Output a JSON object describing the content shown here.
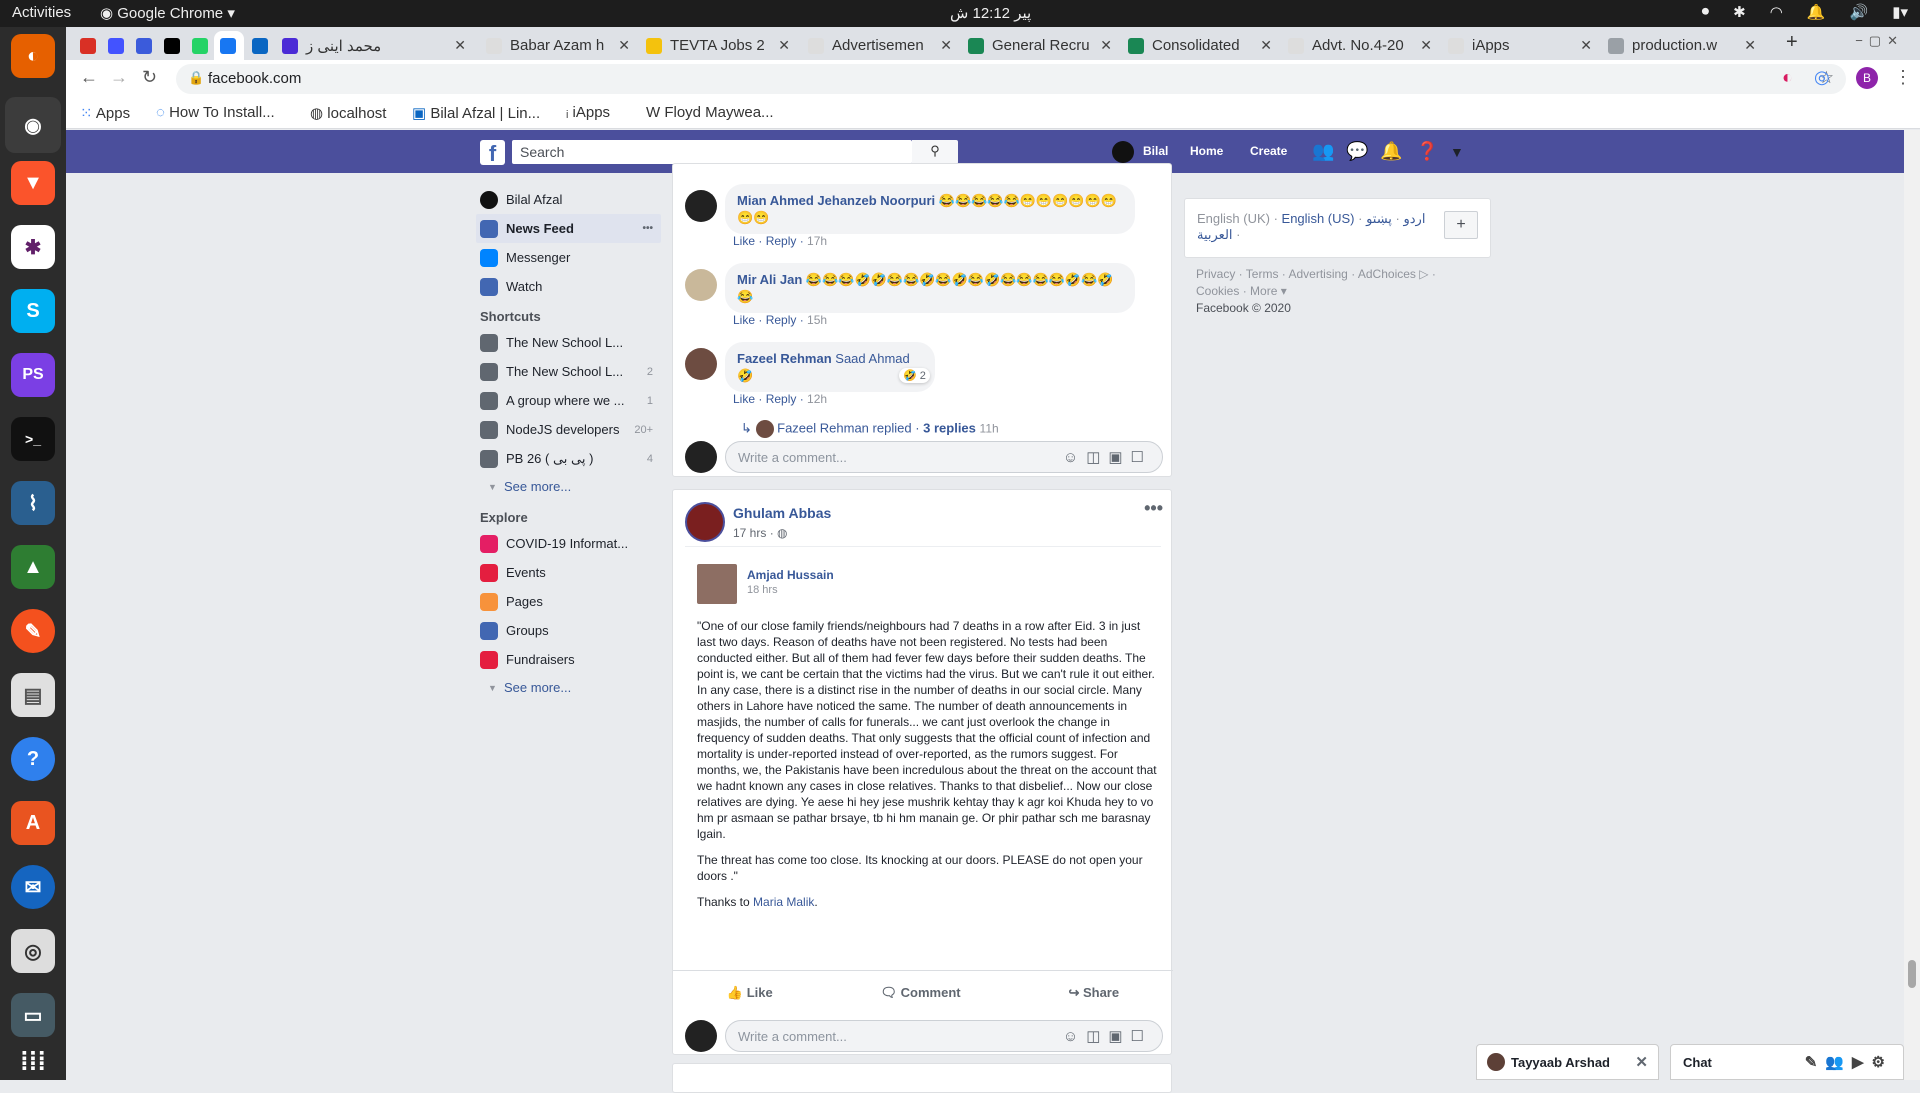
{
  "os": {
    "activities": "Activities",
    "app_name": "Google Chrome",
    "clock": "پیر 12:12 ش"
  },
  "tabs": [
    {
      "label": "",
      "color": "#d93025"
    },
    {
      "label": "",
      "color": "#4353ff"
    },
    {
      "label": "",
      "color": "#3b5bdb"
    },
    {
      "label": "",
      "color": "#000000"
    },
    {
      "label": "",
      "color": "#25d366"
    },
    {
      "label": "",
      "color": "#1877f2"
    },
    {
      "label": "",
      "color": "#0a66c2"
    },
    {
      "label": "محمد اینی ز",
      "color": "#4b2bd6"
    },
    {
      "label": "Babar Azam h",
      "color": "#dddddd"
    },
    {
      "label": "TEVTA Jobs 2",
      "color": "#f4c20d"
    },
    {
      "label": "Advertisemen",
      "color": "#dddddd"
    },
    {
      "label": "General Recru",
      "color": "#1a8754"
    },
    {
      "label": "Consolidated",
      "color": "#1a8754"
    },
    {
      "label": "Advt. No.4-20",
      "color": "#dddddd"
    },
    {
      "label": "iApps",
      "color": "#dddddd"
    },
    {
      "label": "production.w",
      "color": "#9aa0a6"
    }
  ],
  "address": {
    "url": "facebook.com"
  },
  "bookmarks": [
    "Apps",
    "How To Install...",
    "localhost",
    "Bilal Afzal | Lin...",
    "iApps",
    "Floyd Maywea..."
  ],
  "fb_header": {
    "search_placeholder": "Search",
    "user": "Bilal",
    "home": "Home",
    "create": "Create"
  },
  "left_nav": {
    "profile": "Bilal Afzal",
    "main": [
      {
        "label": "News Feed",
        "color": "#4267b2"
      },
      {
        "label": "Messenger",
        "color": "#0084ff"
      },
      {
        "label": "Watch",
        "color": "#4267b2"
      }
    ],
    "shortcuts_title": "Shortcuts",
    "shortcuts": [
      {
        "label": "The New School L...",
        "count": ""
      },
      {
        "label": "The New School L...",
        "count": "2"
      },
      {
        "label": "A group where we ...",
        "count": "1"
      },
      {
        "label": "NodeJS developers",
        "count": "20+"
      },
      {
        "label": "PB 26 ( پی بی )",
        "count": "4"
      }
    ],
    "see_more": "See more...",
    "explore_title": "Explore",
    "explore": [
      {
        "label": "COVID-19 Informat...",
        "color": "#e41e64"
      },
      {
        "label": "Events",
        "color": "#e41e3f"
      },
      {
        "label": "Pages",
        "color": "#f7923b"
      },
      {
        "label": "Groups",
        "color": "#4267b2"
      },
      {
        "label": "Fundraisers",
        "color": "#e41e3f"
      }
    ]
  },
  "comments": [
    {
      "name": "Mian Ahmed Jehanzeb Noorpuri",
      "text": "😂😂😂😂😂😁😁😁😁😁😁😁😁",
      "like": "Like",
      "reply": "Reply",
      "time": "17h"
    },
    {
      "name": "Mir Ali Jan",
      "text": "😂😂😂🤣🤣😂😂🤣😂🤣😂🤣😂😂😂😂🤣😂🤣😂",
      "like": "Like",
      "reply": "Reply",
      "time": "15h"
    },
    {
      "name": "Fazeel Rehman",
      "mention": "Saad Ahmad",
      "text": "🤣",
      "reaction_count": "2",
      "like": "Like",
      "reply": "Reply",
      "time": "12h"
    }
  ],
  "reply_summary": {
    "name": "Fazeel Rehman",
    "replied": "replied",
    "replies": "3 replies",
    "time": "11h"
  },
  "comment_placeholder": "Write a comment...",
  "post": {
    "author": "Ghulam Abbas",
    "time": "17 hrs",
    "shared_author": "Amjad Hussain",
    "shared_time": "18 hrs",
    "paragraphs": [
      "\"One of our close family friends/neighbours had 7 deaths in a row after Eid. 3 in just last two days. Reason of deaths have not been registered. No tests had been conducted either. But all of them had fever few days before their sudden deaths. The point is, we cant be certain that the victims had the virus. But we can't rule it out either. In any case, there is a distinct rise in the number of deaths in our social circle. Many others in Lahore have noticed the same. The number of death announcements in masjids, the number of calls for funerals... we cant just overlook the change in frequency of sudden deaths. That only suggests that the official count of infection and mortality is under-reported instead of over-reported, as the rumors suggest. For months, we, the Pakistanis have been incredulous about the threat on the account that we hadnt known any cases in close relatives. Thanks to that disbelief... Now our close relatives are dying. Ye aese hi hey jese mushrik kehtay thay k agr koi Khuda hey to vo hm pr asmaan se pathar brsaye, tb hi hm manain ge. Or phir pathar sch me barasnay lgain.",
      "The threat has come too close. Its knocking at our doors. PLEASE do not open your doors .\""
    ],
    "thanks_prefix": "Thanks to",
    "thanks_name": "Maria Malik",
    "like": "Like",
    "comment": "Comment",
    "share": "Share"
  },
  "right": {
    "lang_current": "English (UK)",
    "lang_links": [
      "English (US)",
      "اردو",
      "پښتو",
      "العربية"
    ],
    "footer_links": [
      "Privacy",
      "Terms",
      "Advertising",
      "AdChoices",
      "Cookies",
      "More"
    ],
    "copyright": "Facebook © 2020"
  },
  "chat": {
    "contact": "Tayyaab Arshad",
    "title": "Chat"
  }
}
